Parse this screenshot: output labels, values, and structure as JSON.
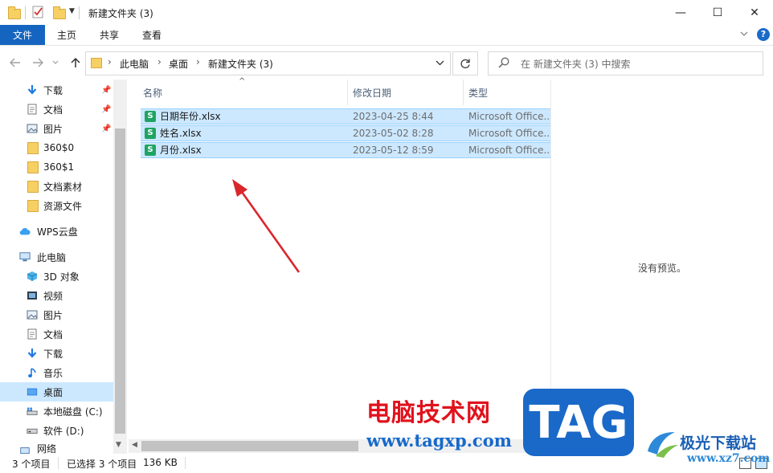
{
  "window": {
    "title": "新建文件夹 (3)",
    "controls": {
      "minimize": "—",
      "maximize": "☐",
      "close": "✕"
    }
  },
  "ribbon": {
    "tabs": [
      "文件",
      "主页",
      "共享",
      "查看"
    ],
    "help": "?",
    "expand_icon": "chevron-down-icon"
  },
  "addressbar": {
    "breadcrumb": [
      "此电脑",
      "桌面",
      "新建文件夹 (3)"
    ],
    "separator": "›"
  },
  "search": {
    "placeholder": "在 新建文件夹 (3) 中搜索"
  },
  "sidebar": {
    "quick_access": [
      {
        "label": "下载",
        "icon": "download-icon",
        "pinned": true
      },
      {
        "label": "文档",
        "icon": "document-icon",
        "pinned": true
      },
      {
        "label": "图片",
        "icon": "picture-icon",
        "pinned": true
      },
      {
        "label": "360$0",
        "icon": "folder-icon",
        "pinned": false
      },
      {
        "label": "360$1",
        "icon": "folder-icon",
        "pinned": false
      },
      {
        "label": "文档素材",
        "icon": "folder-icon",
        "pinned": false
      },
      {
        "label": "资源文件",
        "icon": "folder-icon",
        "pinned": false
      }
    ],
    "wps": {
      "label": "WPS云盘",
      "icon": "cloud-icon"
    },
    "this_pc": {
      "label": "此电脑",
      "icon": "computer-icon"
    },
    "pc_items": [
      {
        "label": "3D 对象",
        "icon": "3d-objects-icon"
      },
      {
        "label": "视频",
        "icon": "video-icon"
      },
      {
        "label": "图片",
        "icon": "picture-icon"
      },
      {
        "label": "文档",
        "icon": "document-icon"
      },
      {
        "label": "下载",
        "icon": "download-icon"
      },
      {
        "label": "音乐",
        "icon": "music-icon"
      },
      {
        "label": "桌面",
        "icon": "desktop-icon",
        "selected": true
      },
      {
        "label": "本地磁盘 (C:)",
        "icon": "drive-c-icon"
      },
      {
        "label": "软件 (D:)",
        "icon": "drive-icon"
      },
      {
        "label": "网络",
        "icon": "network-icon"
      }
    ]
  },
  "filelist": {
    "columns": [
      "名称",
      "修改日期",
      "类型"
    ],
    "rows": [
      {
        "name": "日期年份.xlsx",
        "date": "2023-04-25 8:44",
        "type": "Microsoft Office..."
      },
      {
        "name": "姓名.xlsx",
        "date": "2023-05-02 8:28",
        "type": "Microsoft Office..."
      },
      {
        "name": "月份.xlsx",
        "date": "2023-05-12 8:59",
        "type": "Microsoft Office..."
      }
    ],
    "file_icon_letter": "S"
  },
  "preview": {
    "empty_text": "没有预览。"
  },
  "status": {
    "count": "3 个项目",
    "selected": "已选择 3 个项目",
    "size": "136 KB"
  },
  "watermarks": {
    "site_name": "电脑技术网",
    "site_url": "www.tagxp.com",
    "tag": "TAG",
    "site2_name": "极光下载站",
    "site2_url": "www.xz7.com"
  },
  "colors": {
    "accent": "#1565c0",
    "selection": "#cce8ff",
    "arrow": "#d9262b"
  }
}
